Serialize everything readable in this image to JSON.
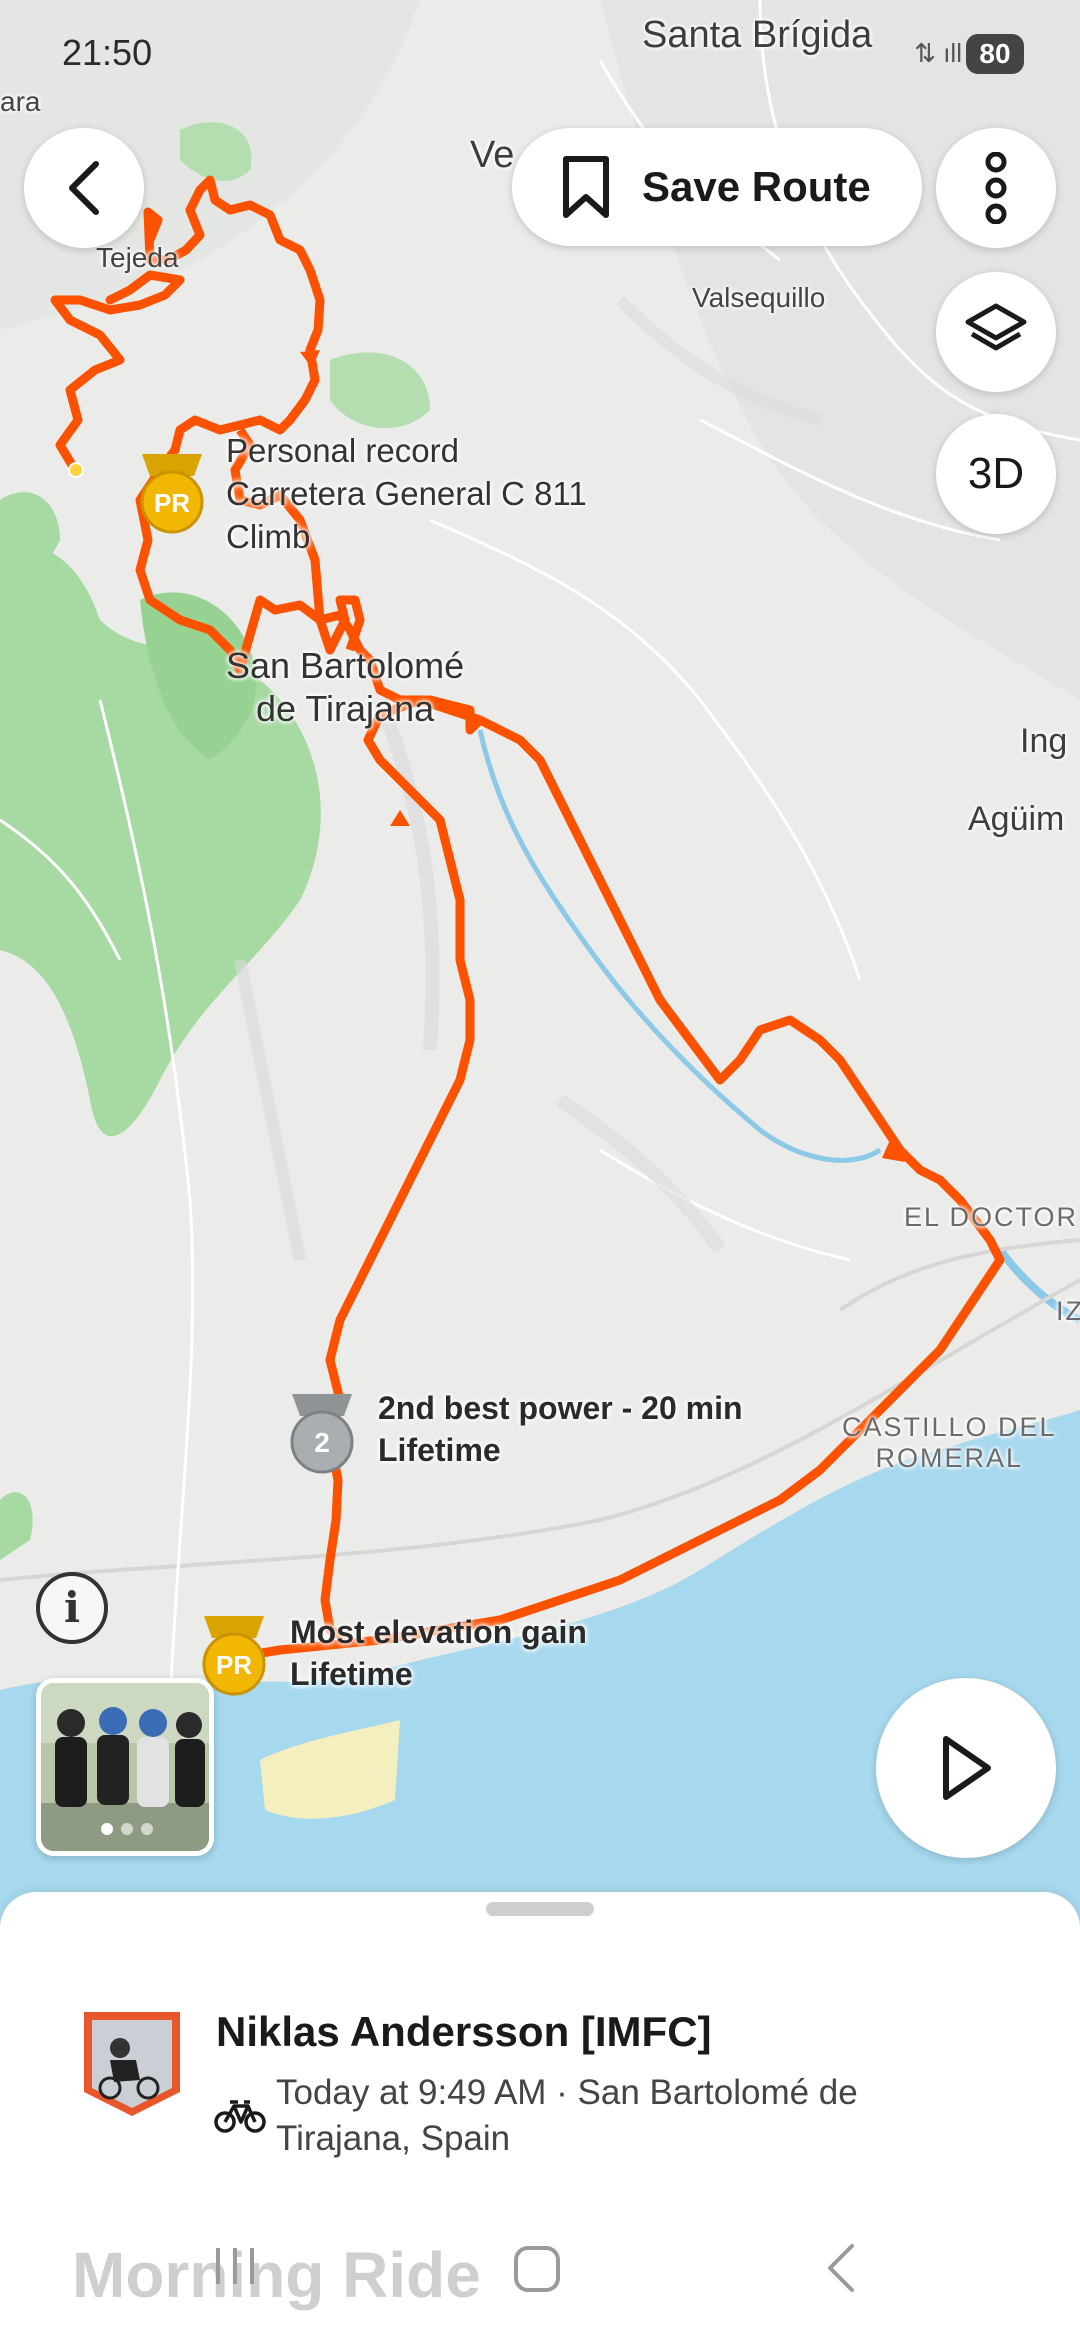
{
  "status_bar": {
    "time": "21:50",
    "signal": "⇅ ıll",
    "battery": "80"
  },
  "toolbar": {
    "save_route_label": "Save Route",
    "threed_label": "3D",
    "info_glyph": "i"
  },
  "map": {
    "places": {
      "santa_brigida": "Santa Brígida",
      "ara": "ara",
      "ve": "Ve",
      "tejeda": "Tejeda",
      "valsequillo": "Valsequillo",
      "san_bartolome": "San Bartolomé\nde Tirajana",
      "ing": "Ing",
      "aguim": "Agüim",
      "el_doctoral": "EL DOCTOR",
      "iz": "IZ",
      "castillo": "CASTILLO DEL\nROMERAL"
    },
    "achievements": [
      {
        "badge": "PR",
        "title": "Personal record",
        "detail": "Carretera General C 811\nClimb"
      },
      {
        "badge": "2",
        "title": "2nd best power - 20 min",
        "detail": "Lifetime"
      },
      {
        "badge": "PR",
        "title": "Most elevation gain",
        "detail": "Lifetime"
      }
    ],
    "route_color": "#fc5200"
  },
  "activity": {
    "athlete": "Niklas Andersson [IMFC]",
    "meta": "Today at 9:49 AM · San Bartolomé de Tirajana, Spain",
    "title": "Morning Ride"
  },
  "icons": {
    "back": "chevron-left-icon",
    "bookmark": "bookmark-icon",
    "more": "more-vertical-icon",
    "layers": "layers-icon",
    "play": "play-icon",
    "bike": "bicycle-icon"
  }
}
